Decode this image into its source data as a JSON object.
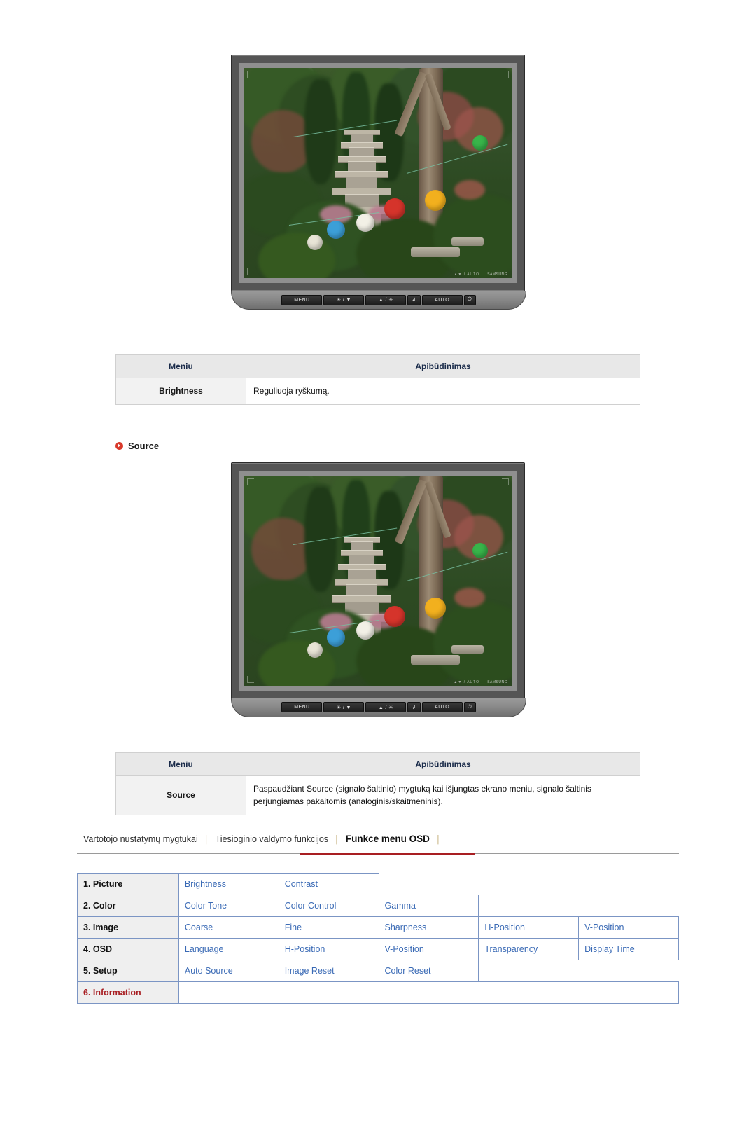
{
  "monitor1": {
    "buttons": [
      "MENU",
      "☀ / ▼",
      "▲ / ☀",
      "↲",
      "AUTO",
      "⏻"
    ],
    "screen_label": "SAMSUNG",
    "screen_icons": "▲▼ / AUTO"
  },
  "monitor2": {
    "buttons": [
      "MENU",
      "☀ / ▼",
      "▲ / ☀",
      "↲",
      "AUTO",
      "⏻"
    ],
    "screen_label": "SAMSUNG",
    "screen_icons": "▲▼ / AUTO"
  },
  "table_brightness": {
    "headers": [
      "Meniu",
      "Apibūdinimas"
    ],
    "rows": [
      {
        "name": "Brightness",
        "desc": "Reguliuoja ryškumą."
      }
    ]
  },
  "section_source": {
    "title": "Source"
  },
  "table_source": {
    "headers": [
      "Meniu",
      "Apibūdinimas"
    ],
    "rows": [
      {
        "name": "Source",
        "desc": "Paspaudžiant Source (signalo šaltinio) mygtuką kai išjungtas ekrano meniu, signalo šaltinis perjungiamas pakaitomis (analoginis/skaitmeninis)."
      }
    ]
  },
  "breadcrumb": {
    "items": [
      {
        "label": "Vartotojo nustatymų mygtukai",
        "active": false
      },
      {
        "label": "Tiesioginio valdymo funkcijos",
        "active": false
      },
      {
        "label": "Funkce menu OSD",
        "active": true
      }
    ],
    "divider": "│"
  },
  "osd_map": {
    "rows": [
      {
        "lead": "1. Picture",
        "cells": [
          "Brightness",
          "Contrast"
        ]
      },
      {
        "lead": "2. Color",
        "cells": [
          "Color Tone",
          "Color Control",
          "Gamma"
        ]
      },
      {
        "lead": "3. Image",
        "cells": [
          "Coarse",
          "Fine",
          "Sharpness",
          "H-Position",
          "V-Position"
        ]
      },
      {
        "lead": "4. OSD",
        "cells": [
          "Language",
          "H-Position",
          "V-Position",
          "Transparency",
          "Display Time"
        ]
      },
      {
        "lead": "5. Setup",
        "cells": [
          "Auto Source",
          "Image Reset",
          "Color Reset"
        ]
      },
      {
        "lead": "6. Information",
        "cells": [],
        "highlight": true
      }
    ]
  },
  "colors": {
    "link": "#3a6ab5",
    "accent_red": "#a81e22",
    "header_text": "#1a2b4a"
  }
}
